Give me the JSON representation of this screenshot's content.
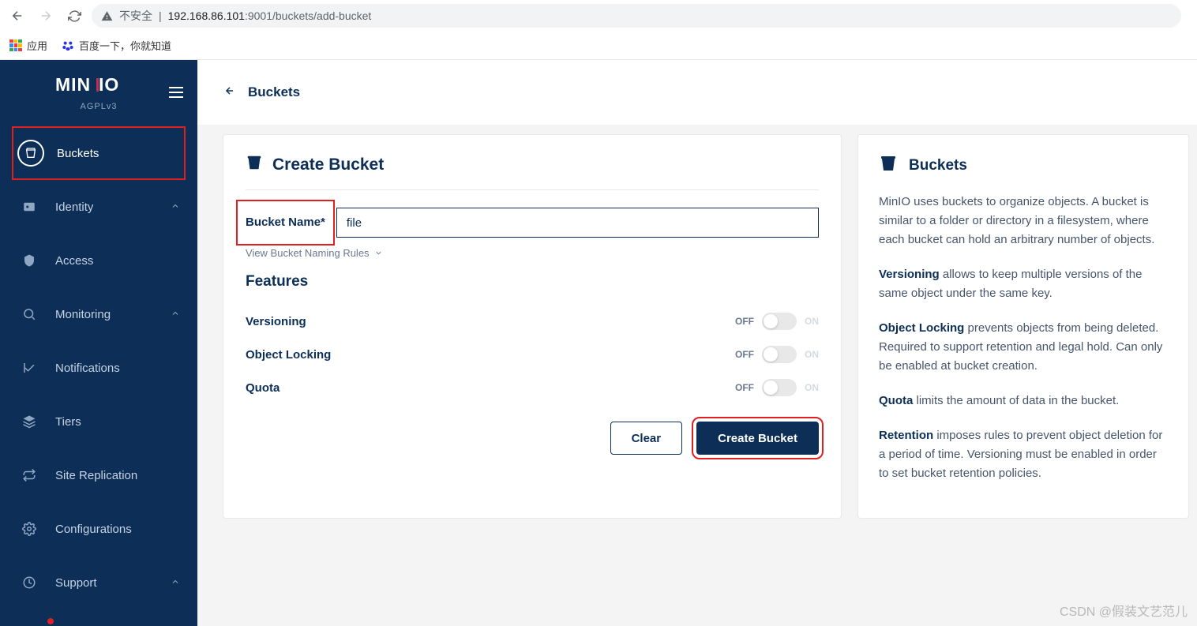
{
  "browser": {
    "insecure_label": "不安全",
    "url_host": "192.168.86.101",
    "url_port_path": ":9001/buckets/add-bucket",
    "bookmarks": {
      "apps": "应用",
      "baidu": "百度一下，你就知道"
    }
  },
  "logo": {
    "name": "MINIO",
    "sub": "AGPLv3"
  },
  "nav": {
    "buckets": "Buckets",
    "identity": "Identity",
    "access": "Access",
    "monitoring": "Monitoring",
    "notifications": "Notifications",
    "tiers": "Tiers",
    "site_replication": "Site Replication",
    "configurations": "Configurations",
    "support": "Support"
  },
  "header": {
    "title": "Buckets"
  },
  "form": {
    "title": "Create Bucket",
    "bucket_name_label": "Bucket Name*",
    "bucket_name_value": "file",
    "naming_rules": "View Bucket Naming Rules",
    "features_title": "Features",
    "features": {
      "versioning": "Versioning",
      "object_locking": "Object Locking",
      "quota": "Quota"
    },
    "toggle": {
      "off": "OFF",
      "on": "ON"
    },
    "buttons": {
      "clear": "Clear",
      "create": "Create Bucket"
    }
  },
  "info": {
    "title": "Buckets",
    "p1": "MinIO uses buckets to organize objects. A bucket is similar to a folder or directory in a filesystem, where each bucket can hold an arbitrary number of objects.",
    "p2a": "Versioning",
    "p2b": " allows to keep multiple versions of the same object under the same key.",
    "p3a": "Object Locking",
    "p3b": " prevents objects from being deleted. Required to support retention and legal hold. Can only be enabled at bucket creation.",
    "p4a": "Quota",
    "p4b": " limits the amount of data in the bucket.",
    "p5a": "Retention",
    "p5b": " imposes rules to prevent object deletion for a period of time. Versioning must be enabled in order to set bucket retention policies."
  },
  "watermark": "CSDN @假装文艺范儿"
}
